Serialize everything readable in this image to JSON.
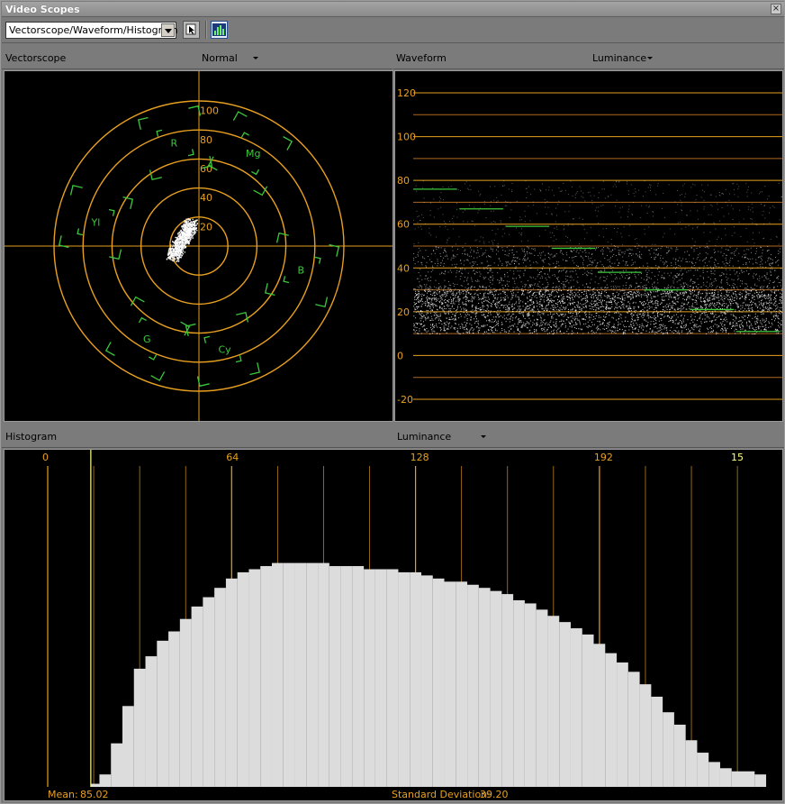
{
  "window": {
    "title": "Video Scopes"
  },
  "toolbar": {
    "layout_select": {
      "value": "Vectorscope/Waveform/Histogram"
    },
    "tools": [
      {
        "icon": "pointer-select-icon"
      },
      {
        "icon": "histogram-view-icon",
        "active": true
      }
    ]
  },
  "vectorscope": {
    "label": "Vectorscope",
    "mode": "Normal",
    "ring_labels": [
      "20",
      "40",
      "60",
      "80",
      "100"
    ],
    "targets": [
      {
        "label": "R",
        "angle": 103
      },
      {
        "label": "Mg",
        "angle": 61
      },
      {
        "label": "B",
        "angle": 347
      },
      {
        "label": "Cy",
        "angle": 283
      },
      {
        "label": "G",
        "angle": 241
      },
      {
        "label": "Yl",
        "angle": 167
      }
    ],
    "colors": {
      "grid": "#e8a020",
      "target": "#3cc83c",
      "trace": "#ffffff"
    }
  },
  "waveform": {
    "label": "Waveform",
    "mode": "Luminance",
    "scale_labels": [
      "120",
      "100",
      "80",
      "60",
      "40",
      "20",
      "0",
      "-20"
    ],
    "scale_values": [
      120,
      100,
      80,
      60,
      40,
      20,
      0,
      -20
    ],
    "y_range": [
      -20,
      120
    ],
    "minor_grid": true,
    "colors": {
      "major": "#e8a020",
      "minor": "#b06820",
      "bars": "#3cc83c"
    }
  },
  "histogram": {
    "label": "Histogram",
    "mode": "Luminance",
    "axis_labels": [
      "0",
      "64",
      "128",
      "192"
    ],
    "cursor_value": "15",
    "stats": {
      "mean_label": "Mean:",
      "mean": "85.02",
      "sd_label": "Standard Deviation:",
      "sd": "39.20"
    },
    "colors": {
      "grid": "#e8a020",
      "bars": "#dcdcdc",
      "highlight": "#ffff80"
    }
  },
  "chart_data": [
    {
      "type": "histogram",
      "title": "Histogram",
      "channel": "Luminance",
      "x_ticks": [
        0,
        64,
        128,
        192
      ],
      "x_range": [
        0,
        255
      ],
      "bins": [
        [
          15,
          1
        ],
        [
          18,
          4
        ],
        [
          22,
          14
        ],
        [
          26,
          26
        ],
        [
          30,
          38
        ],
        [
          34,
          42
        ],
        [
          38,
          47
        ],
        [
          42,
          50
        ],
        [
          46,
          54
        ],
        [
          50,
          58
        ],
        [
          54,
          61
        ],
        [
          58,
          64
        ],
        [
          62,
          67
        ],
        [
          66,
          69
        ],
        [
          70,
          70
        ],
        [
          74,
          71
        ],
        [
          78,
          72
        ],
        [
          82,
          72
        ],
        [
          86,
          72
        ],
        [
          90,
          72
        ],
        [
          94,
          72
        ],
        [
          98,
          71
        ],
        [
          102,
          71
        ],
        [
          106,
          71
        ],
        [
          110,
          70
        ],
        [
          114,
          70
        ],
        [
          118,
          70
        ],
        [
          122,
          69
        ],
        [
          126,
          69
        ],
        [
          130,
          68
        ],
        [
          134,
          67
        ],
        [
          138,
          66
        ],
        [
          142,
          66
        ],
        [
          146,
          65
        ],
        [
          150,
          64
        ],
        [
          154,
          63
        ],
        [
          158,
          62
        ],
        [
          162,
          60
        ],
        [
          166,
          59
        ],
        [
          170,
          57
        ],
        [
          174,
          55
        ],
        [
          178,
          53
        ],
        [
          182,
          51
        ],
        [
          186,
          49
        ],
        [
          190,
          46
        ],
        [
          194,
          43
        ],
        [
          198,
          40
        ],
        [
          202,
          37
        ],
        [
          206,
          33
        ],
        [
          210,
          29
        ],
        [
          214,
          24
        ],
        [
          218,
          20
        ],
        [
          222,
          15
        ],
        [
          226,
          11
        ],
        [
          230,
          8
        ],
        [
          234,
          6
        ],
        [
          238,
          5
        ],
        [
          242,
          5
        ],
        [
          246,
          4
        ]
      ],
      "mean": 85.02,
      "standard_deviation": 39.2
    },
    {
      "type": "bar",
      "title": "Waveform",
      "channel": "Luminance",
      "y_range": [
        -20,
        120
      ],
      "y_ticks": [
        120,
        100,
        80,
        60,
        40,
        20,
        0,
        -20
      ],
      "reference_bars": [
        76,
        67,
        59,
        49,
        38,
        30,
        21,
        11
      ]
    }
  ]
}
